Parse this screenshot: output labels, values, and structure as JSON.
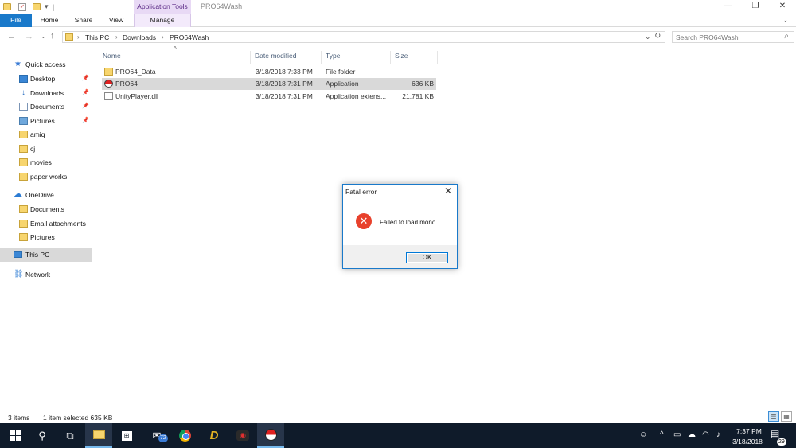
{
  "window": {
    "title": "PRO64Wash",
    "context_tab_header": "Application Tools",
    "controls": {
      "minimize": "—",
      "restore": "❐",
      "close": "✕"
    }
  },
  "ribbon": {
    "tabs": [
      "File",
      "Home",
      "Share",
      "View",
      "Manage"
    ]
  },
  "address": {
    "crumbs": [
      "This PC",
      "Downloads",
      "PRO64Wash"
    ],
    "search_placeholder": "Search PRO64Wash"
  },
  "nav": {
    "quick_access": "Quick access",
    "quick_items": [
      "Desktop",
      "Downloads",
      "Documents",
      "Pictures",
      "amiq",
      "cj",
      "movies",
      "paper works"
    ],
    "onedrive": "OneDrive",
    "onedrive_items": [
      "Documents",
      "Email attachments",
      "Pictures"
    ],
    "this_pc": "This PC",
    "network": "Network"
  },
  "files": {
    "columns": [
      "Name",
      "Date modified",
      "Type",
      "Size"
    ],
    "rows": [
      {
        "name": "PRO64_Data",
        "date": "3/18/2018 7:33 PM",
        "type": "File folder",
        "size": "",
        "icon": "folder-icon"
      },
      {
        "name": "PRO64",
        "date": "3/18/2018 7:31 PM",
        "type": "Application",
        "size": "636 KB",
        "icon": "pokeball-app-icon"
      },
      {
        "name": "UnityPlayer.dll",
        "date": "3/18/2018 7:31 PM",
        "type": "Application extens...",
        "size": "21,781 KB",
        "icon": "dll-file-icon"
      }
    ]
  },
  "dialog": {
    "title": "Fatal error",
    "message": "Failed to load mono",
    "ok_label": "OK"
  },
  "status": {
    "items_count": "3 items",
    "selection": "1 item selected  635 KB"
  },
  "taskbar": {
    "mail_badge": "72",
    "time": "7:37 PM",
    "date": "3/18/2018",
    "notification_count": "29"
  },
  "colors": {
    "file_tab": "#1979ca",
    "context_tab": "#e8d9f5",
    "taskbar": "#0f1b2a",
    "selection": "#d9d9d9",
    "error_icon": "#e8412c"
  }
}
